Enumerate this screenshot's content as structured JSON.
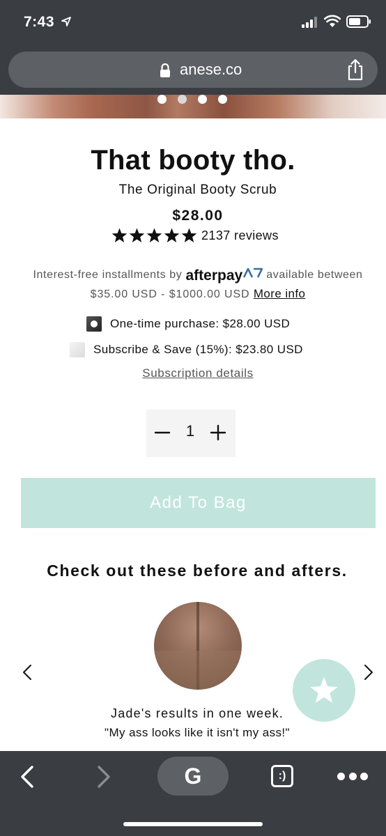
{
  "status_bar": {
    "time": "7:43",
    "icons": [
      "location-arrow-icon",
      "signal-icon",
      "wifi-icon",
      "battery-icon"
    ]
  },
  "browser": {
    "url": "anese.co",
    "lock_icon": "lock-icon",
    "share_icon": "share-icon",
    "toolbar": {
      "back_icon": "chevron-left-icon",
      "forward_icon": "chevron-right-icon",
      "google_label": "G",
      "tabs_label": ":)",
      "more_icon": "more-dots-icon"
    }
  },
  "hero": {
    "slide_count": 4,
    "active_slide": 2
  },
  "product": {
    "title": "That booty tho.",
    "subtitle": "The Original Booty Scrub",
    "price": "$28.00",
    "rating": 5,
    "reviews_label": "2137 reviews"
  },
  "afterpay": {
    "prefix": "Interest-free installments by",
    "brand": "afterpay",
    "suffix": "available between",
    "range": "$35.00 USD - $1000.00 USD",
    "more_info": "More info"
  },
  "purchase_options": {
    "one_time": {
      "label": "One-time purchase: $28.00 USD",
      "selected": true
    },
    "subscribe": {
      "label": "Subscribe & Save (15%): $23.80 USD",
      "selected": false
    },
    "details_link": "Subscription details"
  },
  "quantity": {
    "value": "1",
    "minus_icon": "minus-icon",
    "plus_icon": "plus-icon"
  },
  "cart": {
    "add_label": "Add To Bag",
    "button_color": "#c1e5dc"
  },
  "before_after": {
    "heading": "Check out these before and afters.",
    "caption": "Jade's results in one week.",
    "quote": "\"My ass looks like it isn't my ass!\""
  },
  "theme": {
    "chrome_dark": "#3a3d42",
    "pill_gray": "#5d6064",
    "accent_mint": "#c1e5dc"
  }
}
